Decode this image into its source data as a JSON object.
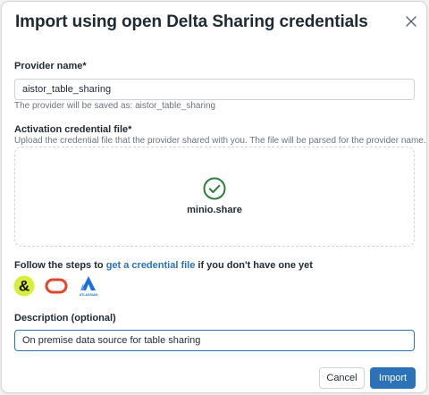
{
  "dialog": {
    "title": "Import using open Delta Sharing credentials"
  },
  "provider_name": {
    "label": "Provider name*",
    "value": "aistor_table_sharing",
    "hint": "The provider will be saved as: aistor_table_sharing"
  },
  "credential_file": {
    "label": "Activation credential file*",
    "hint": "Upload the credential file that the provider shared with you. The file will be parsed for the provider name.",
    "file_name": "minio.share"
  },
  "steps": {
    "prefix": "Follow the steps to",
    "link_text": "get a credential file",
    "suffix": "if you don't have one yet",
    "providers": [
      {
        "icon": "ampersand-logo-icon",
        "color": "#d7ef3c"
      },
      {
        "icon": "oracle-logo-icon",
        "color": "#e2462a"
      },
      {
        "icon": "atlassian-logo-icon",
        "color": "#1d6fe0",
        "text": "ATLASSIAN"
      }
    ]
  },
  "description": {
    "label": "Description (optional)",
    "value": "On premise data source for table sharing"
  },
  "footer": {
    "cancel_label": "Cancel",
    "import_label": "Import"
  },
  "colors": {
    "accent": "#2b72b8",
    "success": "#2f7d3b"
  }
}
